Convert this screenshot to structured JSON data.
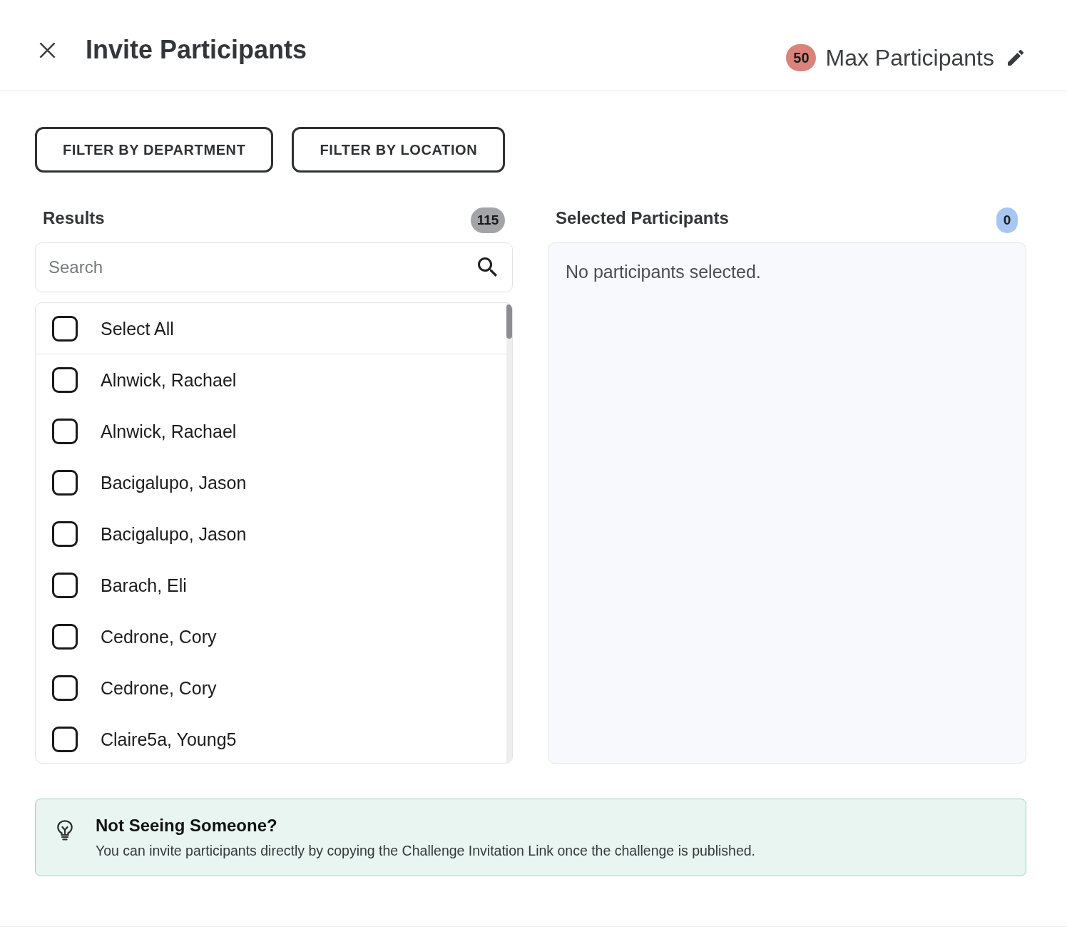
{
  "header": {
    "title": "Invite Participants",
    "max_participants": {
      "count": "50",
      "label": "Max Participants"
    }
  },
  "filters": [
    {
      "label": "FILTER BY DEPARTMENT"
    },
    {
      "label": "FILTER BY LOCATION"
    }
  ],
  "results": {
    "title": "Results",
    "count": "115",
    "search": {
      "placeholder": "Search"
    },
    "select_all": {
      "label": "Select All",
      "checked": false
    },
    "items": [
      {
        "name": "Alnwick, Rachael",
        "checked": false
      },
      {
        "name": "Alnwick, Rachael",
        "checked": false
      },
      {
        "name": "Bacigalupo, Jason",
        "checked": false
      },
      {
        "name": "Bacigalupo, Jason",
        "checked": false
      },
      {
        "name": "Barach, Eli",
        "checked": false
      },
      {
        "name": "Cedrone, Cory",
        "checked": false
      },
      {
        "name": "Cedrone, Cory",
        "checked": false
      },
      {
        "name": "Claire5a, Young5",
        "checked": false
      }
    ]
  },
  "selected": {
    "title": "Selected Participants",
    "count": "0",
    "empty_text": "No participants selected."
  },
  "notice": {
    "title": "Not Seeing Someone?",
    "text": "You can invite participants directly by copying the Challenge Invitation Link once the challenge is published."
  }
}
